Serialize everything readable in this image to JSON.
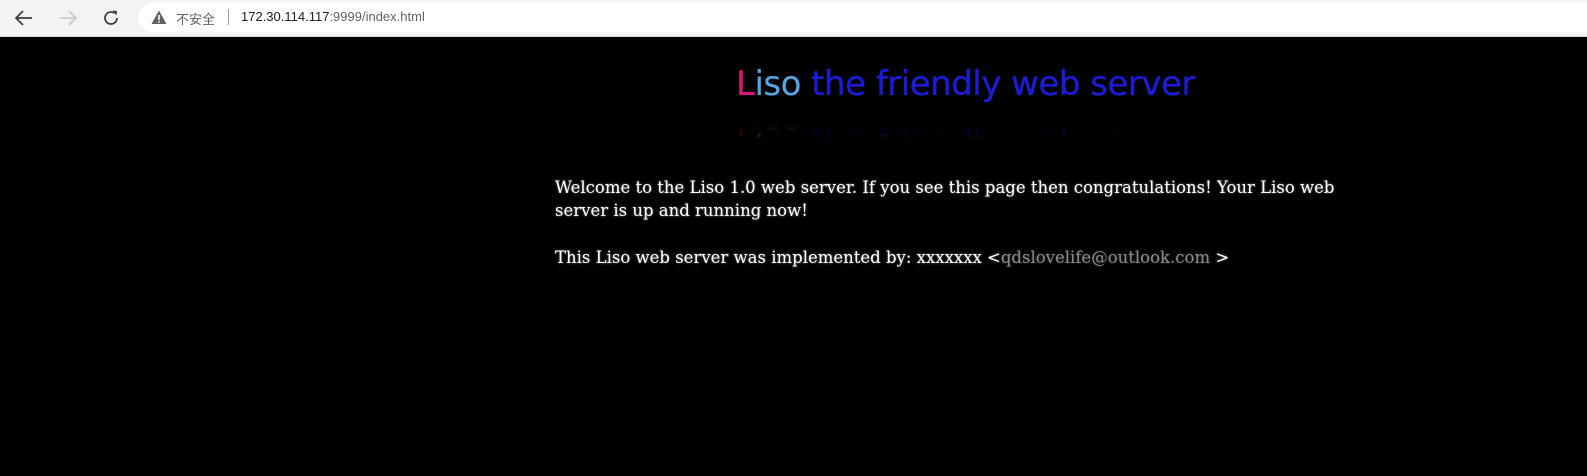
{
  "browser": {
    "security_label": "不安全",
    "url_host": "172.30.114.117",
    "url_rest": ":9999/index.html"
  },
  "logo": {
    "first_letter": "L",
    "rest_of_name": "iso",
    "tagline": " the friendly web server"
  },
  "content": {
    "welcome": "Welcome to the Liso 1.0 web server. If you see this page then congratulations! Your Liso web server is up and running now!",
    "implemented_prefix": "This Liso web server was implemented by: xxxxxxx <",
    "email": "qdslovelife@outlook.com",
    "implemented_suffix": " >"
  },
  "colors": {
    "logo_L": "#e2147a",
    "logo_iso": "#53a7e8",
    "logo_tagline": "#1a1ae6",
    "page_bg": "#000000"
  }
}
